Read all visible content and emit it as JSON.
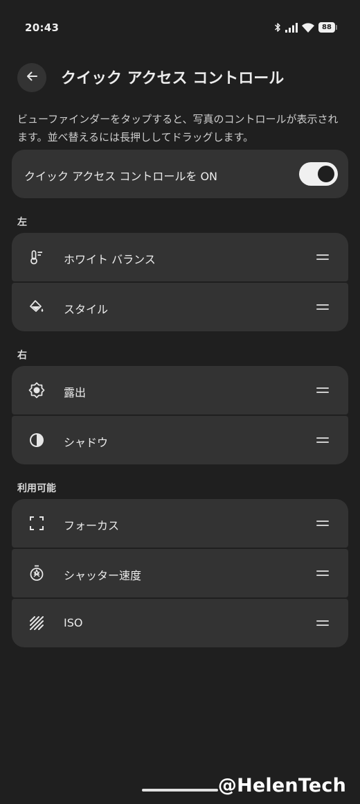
{
  "status_bar": {
    "time": "20:43",
    "battery": "88",
    "icons": [
      "bluetooth-icon",
      "signal-icon",
      "wifi-icon",
      "battery-icon"
    ]
  },
  "header": {
    "back_icon": "arrow-left-icon",
    "title": "クイック アクセス コントロール"
  },
  "description": "ビューファインダーをタップすると、写真のコントロールが表示されます。並べ替えるには長押ししてドラッグします。",
  "toggle": {
    "label": "クイック アクセス コントロールを ON",
    "on": true
  },
  "sections": {
    "left": {
      "label": "左",
      "items": [
        {
          "label": "ホワイト バランス",
          "icon": "thermometer-icon"
        },
        {
          "label": "スタイル",
          "icon": "paint-bucket-icon"
        }
      ]
    },
    "right": {
      "label": "右",
      "items": [
        {
          "label": "露出",
          "icon": "brightness-icon"
        },
        {
          "label": "シャドウ",
          "icon": "contrast-icon"
        }
      ]
    },
    "available": {
      "label": "利用可能",
      "items": [
        {
          "label": "フォーカス",
          "icon": "focus-frame-icon"
        },
        {
          "label": "シャッター速度",
          "icon": "shutter-speed-icon"
        },
        {
          "label": "ISO",
          "icon": "iso-grain-icon"
        }
      ]
    }
  },
  "watermark": "@HelenTech",
  "colors": {
    "background": "#1f1f1f",
    "card": "#333333",
    "text": "#ececec",
    "switch_track": "#f0f0f0"
  }
}
